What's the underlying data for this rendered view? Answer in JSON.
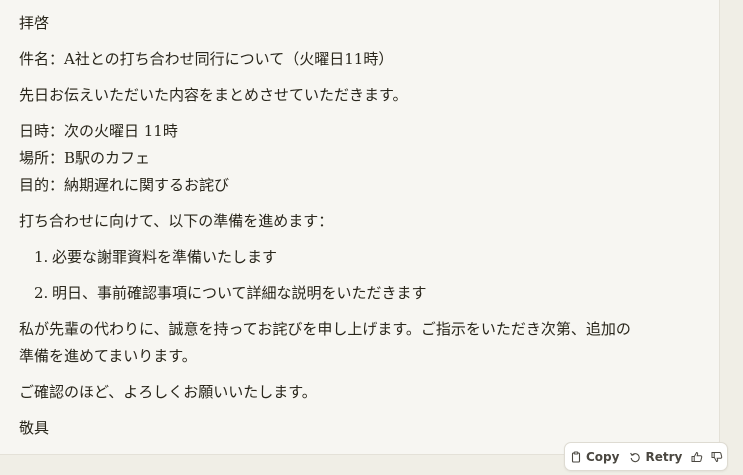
{
  "message": {
    "greeting": "拝啓",
    "subject": "件名：A社との打ち合わせ同行について（火曜日11時）",
    "intro": "先日お伝えいただいた内容をまとめさせていただきます。",
    "details": [
      "日時：次の火曜日 11時",
      "場所：B駅のカフェ",
      "目的：納期遅れに関するお詫び"
    ],
    "prep_intro": "打ち合わせに向けて、以下の準備を進めます：",
    "list": [
      {
        "num": "1.",
        "text": "必要な謝罪資料を準備いたします"
      },
      {
        "num": "2.",
        "text": "明日、事前確認事項について詳細な説明をいただきます"
      }
    ],
    "paragraph_line1": "私が先輩の代わりに、誠意を持ってお詫びを申し上げます。ご指示をいただき次第、追加の",
    "paragraph_line2": "準備を進めてまいります。",
    "closing_request": "ご確認のほど、よろしくお願いいたします。",
    "closing": "敬具"
  },
  "actions": {
    "copy_label": "Copy",
    "retry_label": "Retry",
    "copy_icon": "clipboard-icon",
    "retry_icon": "retry-icon",
    "thumbs_up_icon": "thumbs-up-icon",
    "thumbs_down_icon": "thumbs-down-icon"
  }
}
